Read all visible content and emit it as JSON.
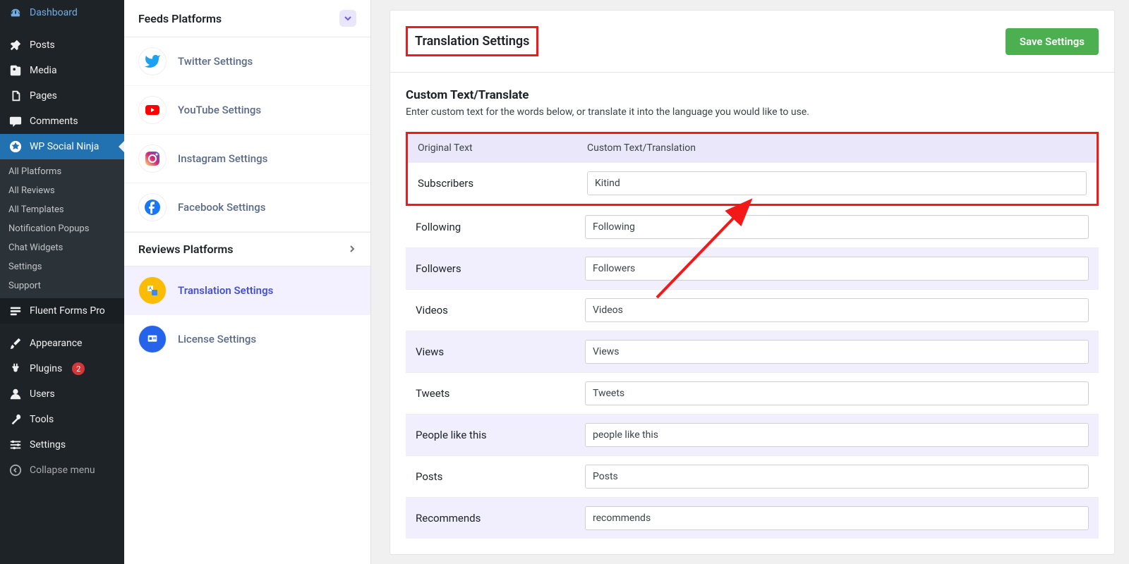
{
  "wp_sidebar": {
    "items": [
      {
        "label": "Dashboard",
        "icon": "dashboard"
      },
      {
        "label": "Posts",
        "icon": "pin"
      },
      {
        "label": "Media",
        "icon": "media"
      },
      {
        "label": "Pages",
        "icon": "pages"
      },
      {
        "label": "Comments",
        "icon": "comment"
      },
      {
        "label": "WP Social Ninja",
        "icon": "star",
        "active": true
      },
      {
        "label": "Fluent Forms Pro",
        "icon": "forms"
      },
      {
        "label": "Appearance",
        "icon": "brush"
      },
      {
        "label": "Plugins",
        "icon": "plug",
        "badge": "2"
      },
      {
        "label": "Users",
        "icon": "user"
      },
      {
        "label": "Tools",
        "icon": "wrench"
      },
      {
        "label": "Settings",
        "icon": "settings"
      },
      {
        "label": "Collapse menu",
        "icon": "collapse"
      }
    ],
    "submenu": [
      "All Platforms",
      "All Reviews",
      "All Templates",
      "Notification Popups",
      "Chat Widgets",
      "Settings",
      "Support"
    ]
  },
  "sec_sidebar": {
    "feeds_title": "Feeds Platforms",
    "feeds": [
      {
        "label": "Twitter Settings",
        "icon": "twitter"
      },
      {
        "label": "YouTube Settings",
        "icon": "youtube"
      },
      {
        "label": "Instagram Settings",
        "icon": "instagram"
      },
      {
        "label": "Facebook Settings",
        "icon": "facebook"
      }
    ],
    "reviews_title": "Reviews Platforms",
    "reviews": [
      {
        "label": "Translation Settings",
        "icon": "translate",
        "active": true
      },
      {
        "label": "License Settings",
        "icon": "license"
      }
    ]
  },
  "panel": {
    "title": "Translation Settings",
    "save_button": "Save Settings",
    "sub_title": "Custom Text/Translate",
    "sub_desc": "Enter custom text for the words below, or translate it into the language you would like to use.",
    "col_original": "Original Text",
    "col_custom": "Custom Text/Translation",
    "rows": [
      {
        "original": "Subscribers",
        "custom": "Kitind"
      },
      {
        "original": "Following",
        "custom": "Following"
      },
      {
        "original": "Followers",
        "custom": "Followers"
      },
      {
        "original": "Videos",
        "custom": "Videos"
      },
      {
        "original": "Views",
        "custom": "Views"
      },
      {
        "original": "Tweets",
        "custom": "Tweets"
      },
      {
        "original": "People like this",
        "custom": "people like this"
      },
      {
        "original": "Posts",
        "custom": "Posts"
      },
      {
        "original": "Recommends",
        "custom": "recommends"
      }
    ]
  }
}
